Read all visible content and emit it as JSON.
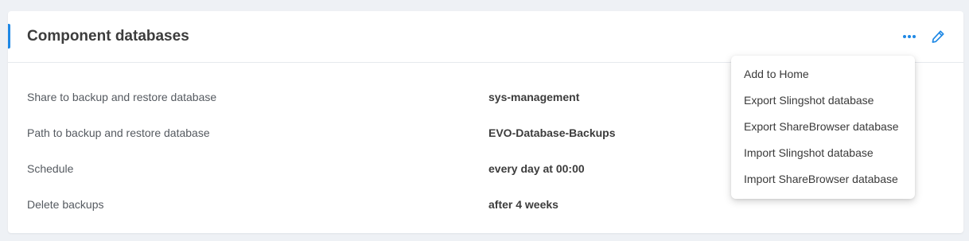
{
  "card": {
    "title": "Component databases"
  },
  "header": {
    "more_icon": "more-horizontal-icon",
    "edit_icon": "pencil-icon"
  },
  "rows": [
    {
      "label": "Share to backup and restore database",
      "value": "sys-management"
    },
    {
      "label": "Path to backup and restore database",
      "value": "EVO-Database-Backups"
    },
    {
      "label": "Schedule",
      "value": "every day at 00:00"
    },
    {
      "label": "Delete backups",
      "value": "after 4 weeks"
    }
  ],
  "menu": {
    "items": [
      "Add to Home",
      "Export Slingshot database",
      "Export ShareBrowser database",
      "Import Slingshot database",
      "Import ShareBrowser database"
    ]
  },
  "colors": {
    "accent": "#1e88e5",
    "background": "#eef1f5",
    "card": "#ffffff"
  }
}
